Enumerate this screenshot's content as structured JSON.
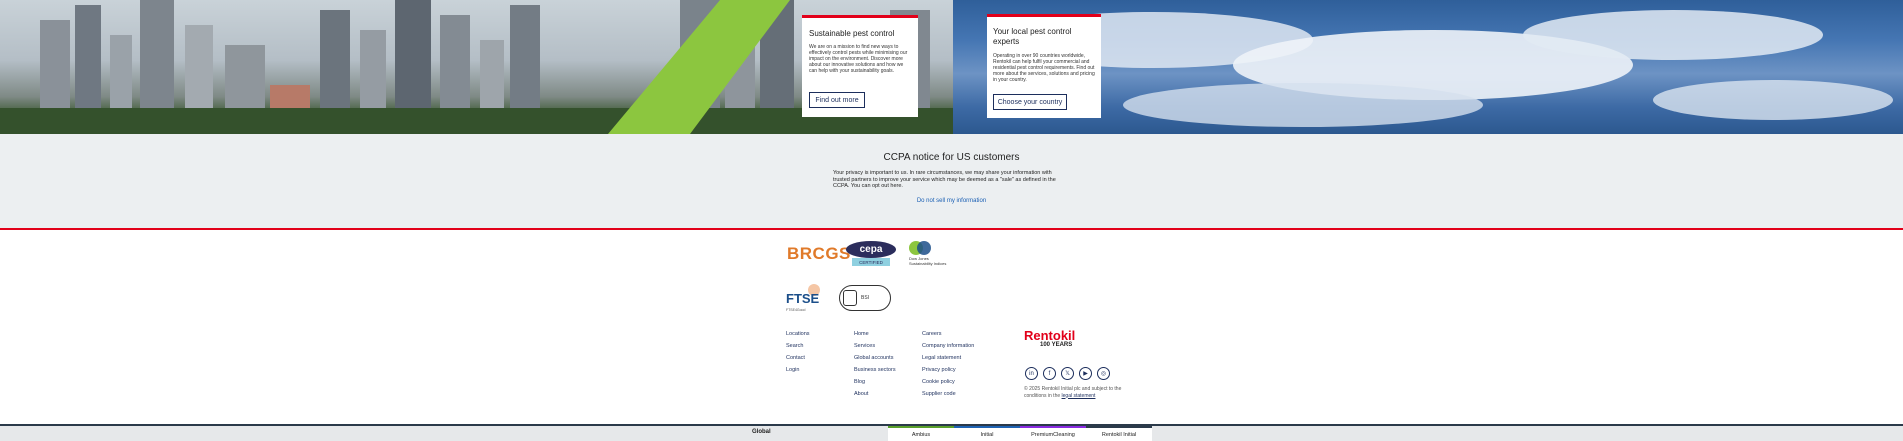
{
  "cards": {
    "sustainable": {
      "title": "Sustainable pest control",
      "body": "We are on a mission to find new ways to effectively control pests while minimising our impact on the environment. Discover more about our innovative solutions and how we can help with your sustainability goals.",
      "button": "Find out more"
    },
    "local": {
      "title": "Your local pest control experts",
      "body": "Operating in over 90 countries worldwide, Rentokil can help fulfil your commercial and residential pest control requirements. Find out more about the services, solutions and pricing in your country.",
      "button": "Choose your country"
    }
  },
  "ccpa": {
    "title": "CCPA notice for US customers",
    "body": "Your privacy is important to us. In rare circumstances, we may share your information with trusted partners to improve your service which may be deemed as a \"sale\" as defined in the CCPA. You can opt out here.",
    "link": "Do not sell my information"
  },
  "logos": {
    "brcgs": "BRCGS",
    "cepa": "cepa",
    "cepa_sub": "CERTIFIED",
    "dj_line1": "Dow Jones",
    "dj_line2": "Sustainability Indices",
    "ftse": "FTSE",
    "ftse_sub": "FTSE4Good",
    "bsi": "BSI"
  },
  "footer": {
    "col1": [
      "Locations",
      "Search",
      "Contact",
      "Login"
    ],
    "col2": [
      "Home",
      "Services",
      "Global accounts",
      "Business sectors",
      "Blog",
      "About"
    ],
    "col3": [
      "Careers",
      "Company information",
      "Legal statement",
      "Privacy policy",
      "Cookie policy",
      "Supplier code"
    ],
    "brand": "Rentokil",
    "brand_sub": "100 YEARS",
    "social": [
      "linkedin-icon",
      "facebook-icon",
      "twitter-icon",
      "youtube-icon",
      "instagram-icon"
    ],
    "social_glyphs": [
      "in",
      "f",
      "𝕏",
      "▶",
      "◎"
    ],
    "copyright_prefix": "© 2025 Rentokil Initial plc and subject to the conditions in the",
    "copyright_link": "legal statement"
  },
  "bottom": {
    "global": "Global",
    "tabs": [
      "Ambius",
      "Initial",
      "PremiumCleaning",
      "Rentokil Initial"
    ],
    "tab_colors": [
      "#5aa02c",
      "#1e63b4",
      "#8a2be2",
      "#e2001a"
    ]
  }
}
